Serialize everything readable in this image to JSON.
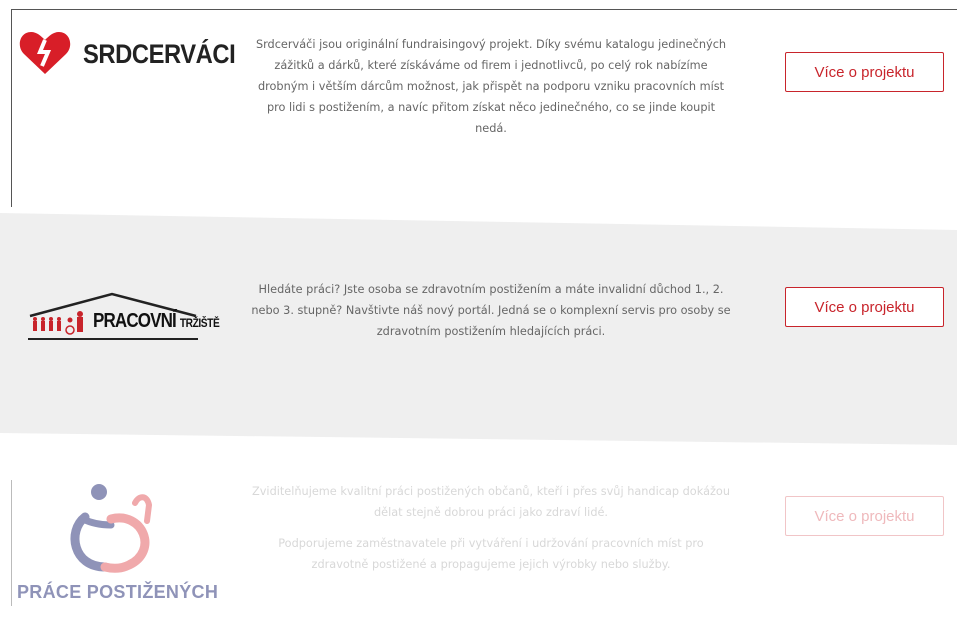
{
  "projects": [
    {
      "logo_text": "SRDCERVÁCI",
      "logo_icon": "heart-icon",
      "description": [
        "Srdcerváči jsou originální fundraisingový projekt. Díky svému katalogu jedinečných zážitků a dárků, které získáváme od firem i jednotlivců, po celý rok nabízíme drobným i větším dárcům možnost, jak přispět na podporu vzniku pracovních míst pro lidi s postižením, a navíc přitom získat něco jedinečného, co se jinde koupit nedá."
      ],
      "button_label": "Více o projektu"
    },
    {
      "logo_text_main": "PRACOVNÍ",
      "logo_text_small": "TRŽIŠTĚ",
      "logo_icon": "people-house-icon",
      "description": [
        "Hledáte práci? Jste osoba se zdravotním postižením a máte invalidní důchod 1., 2. nebo 3. stupně? Navštivte náš nový portál. Jedná se o komplexní servis pro osoby se zdravotním postižením hledajících práci."
      ],
      "button_label": "Více o projektu"
    },
    {
      "logo_text": "PRÁCE POSTIŽENÝCH",
      "logo_icon": "person-hand-icon",
      "description": [
        "Zviditelňujeme kvalitní práci postižených občanů, kteří i přes svůj handicap dokážou dělat stejně dobrou práci jako zdraví lidé.",
        "Podporujeme zaměstnavatele při vytváření i udržování pracovních míst pro zdravotně postižené a propagujeme jejich výrobky nebo služby."
      ],
      "button_label": "Více o projektu"
    }
  ],
  "colors": {
    "accent": "#c8242b",
    "section_gray": "#efefef",
    "logo3_blue": "#8f93b8",
    "logo3_pink": "#f0a9ab"
  }
}
